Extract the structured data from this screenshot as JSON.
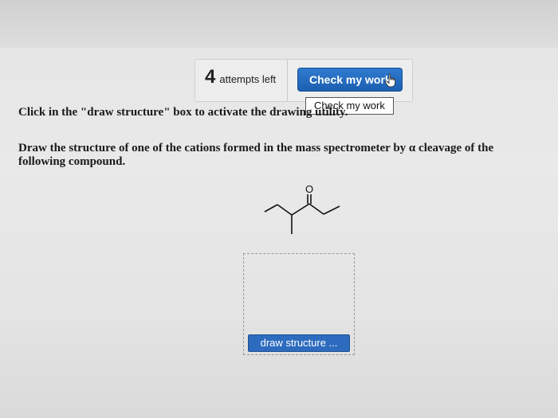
{
  "toolbar": {
    "attempts_count": "4",
    "attempts_label": "attempts left",
    "check_button_label": "Check my work"
  },
  "tooltip": {
    "text": "Check my work"
  },
  "instruction": {
    "text": "Click in the \"draw structure\" box to activate the drawing utility."
  },
  "question": {
    "text": "Draw the structure of one of the cations formed in the mass spectrometer by α cleavage of the following compound."
  },
  "molecule": {
    "carbonyl_atom_label": "O"
  },
  "draw_area": {
    "button_label": "draw structure ..."
  },
  "colors": {
    "accent": "#1f64b8",
    "draw_button": "#2d6bbf",
    "background": "#e6e6e6"
  }
}
